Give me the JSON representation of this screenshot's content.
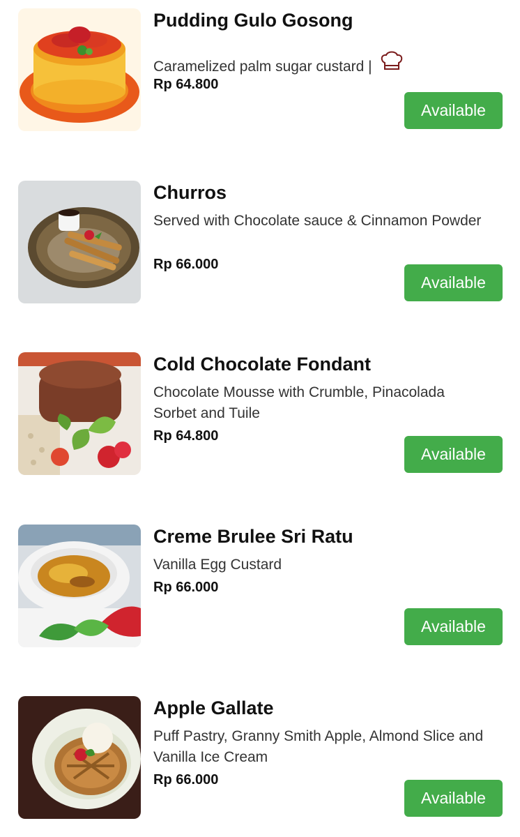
{
  "menu": {
    "items": [
      {
        "name": "Pudding Gulo Gosong",
        "description": "Caramelized palm sugar custard |",
        "price": "Rp 64.800",
        "status": "Available",
        "badge_icon": "chef-hat-icon"
      },
      {
        "name": "Churros",
        "description": "Served with Chocolate sauce & Cinnamon Powder",
        "price": "Rp 66.000",
        "status": "Available"
      },
      {
        "name": "Cold Chocolate Fondant",
        "description": "Chocolate Mousse with Crumble, Pinacolada Sorbet and Tuile",
        "price": "Rp 64.800",
        "status": "Available"
      },
      {
        "name": "Creme Brulee Sri Ratu",
        "description": "Vanilla Egg Custard",
        "price": "Rp 66.000",
        "status": "Available"
      },
      {
        "name": "Apple Gallate",
        "description": "Puff Pastry, Granny Smith Apple, Almond Slice and Vanilla Ice Cream",
        "price": "Rp 66.000",
        "status": "Available"
      }
    ]
  },
  "colors": {
    "available_button": "#43ac4a",
    "button_text": "#ffffff",
    "title_text": "#111111"
  }
}
